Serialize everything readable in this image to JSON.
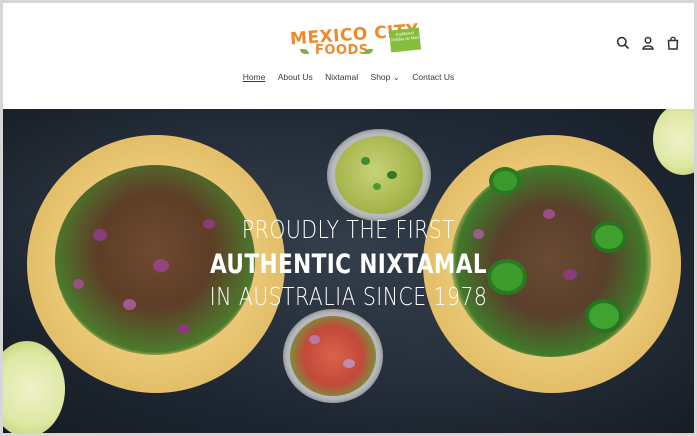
{
  "brand": {
    "name_line1": "MEXICO CITY",
    "name_line2": "FOODS",
    "tagline": "Traditional Tortillas de Maiz"
  },
  "nav": {
    "items": [
      {
        "label": "Home",
        "active": true
      },
      {
        "label": "About Us"
      },
      {
        "label": "Nixtamal"
      },
      {
        "label": "Shop ⌄"
      },
      {
        "label": "Contact Us"
      }
    ]
  },
  "header_icons": [
    "search-icon",
    "account-icon",
    "cart-icon"
  ],
  "hero": {
    "line1": "PROUDLY THE FIRST",
    "line2": "AUTHENTIC NIXTAMAL",
    "line3": "IN AUSTRALIA SINCE 1978"
  },
  "colors": {
    "brand_orange": "#ee8a2a",
    "brand_green": "#86bd3d",
    "hero_bg": "#1e2733"
  }
}
